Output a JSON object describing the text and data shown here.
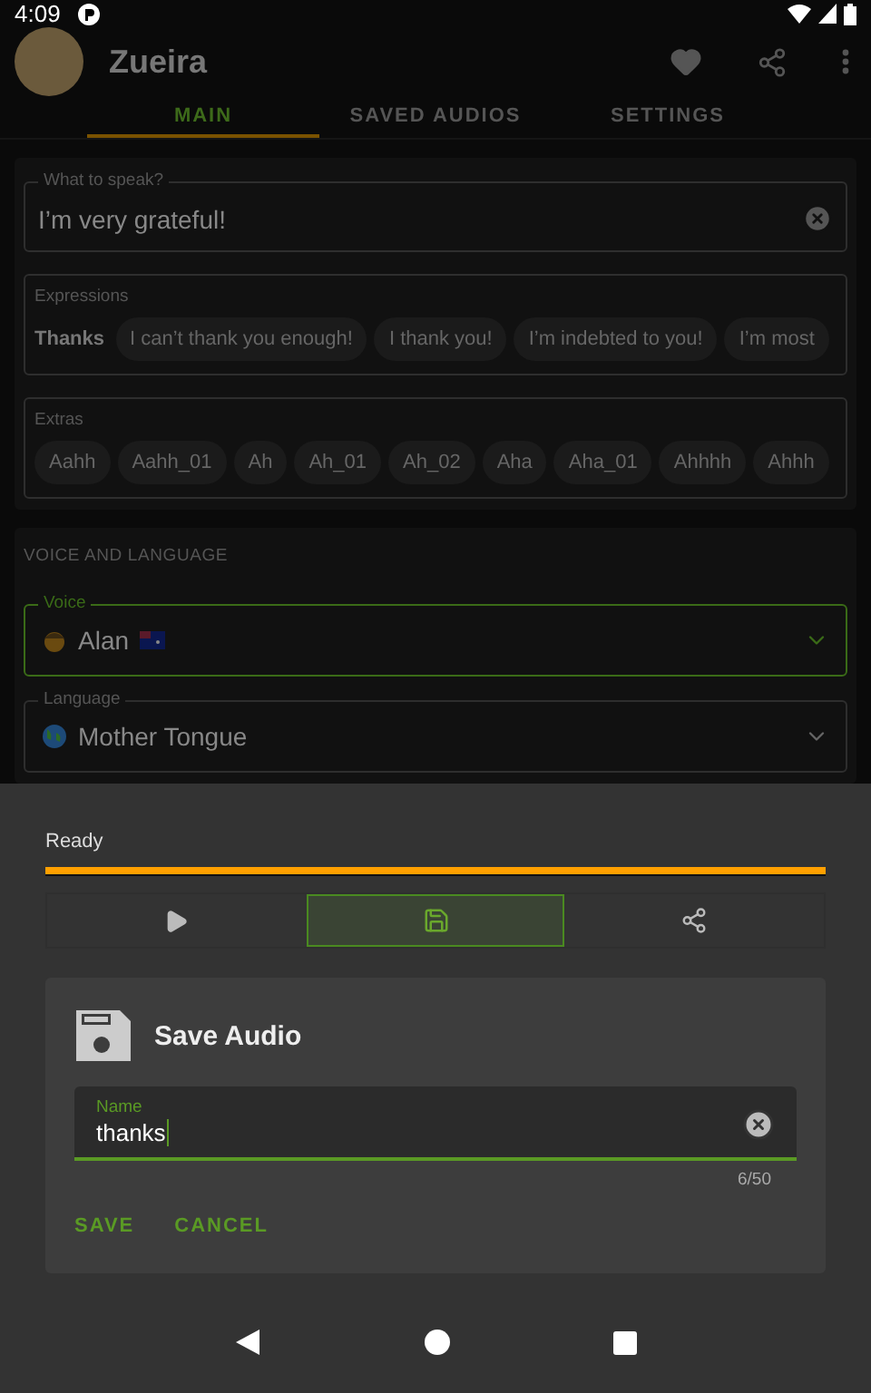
{
  "status_bar": {
    "time": "4:09"
  },
  "app_bar": {
    "title": "Zueira"
  },
  "tabs": [
    {
      "label": "MAIN",
      "selected": true
    },
    {
      "label": "SAVED AUDIOS",
      "selected": false
    },
    {
      "label": "SETTINGS",
      "selected": false
    }
  ],
  "speak_field": {
    "label": "What to speak?",
    "value": "I’m very grateful!"
  },
  "expressions": {
    "title": "Expressions",
    "category": "Thanks",
    "chips": [
      "I can’t thank you enough!",
      "I thank you!",
      "I’m indebted to you!",
      "I’m most"
    ]
  },
  "extras": {
    "title": "Extras",
    "chips": [
      "Aahh",
      "Aahh_01",
      "Ah",
      "Ah_01",
      "Ah_02",
      "Aha",
      "Aha_01",
      "Ahhhh",
      "Ahhh"
    ]
  },
  "voice_section": {
    "title": "VOICE AND LANGUAGE",
    "fields": [
      {
        "label": "Voice",
        "value": "Alan",
        "focused": true
      },
      {
        "label": "Language",
        "value": "Mother Tongue",
        "focused": false
      }
    ]
  },
  "player": {
    "status": "Ready",
    "level": 1,
    "actions": [
      {
        "kind": "play",
        "selected": false
      },
      {
        "kind": "save",
        "selected": true
      },
      {
        "kind": "share",
        "selected": false
      }
    ]
  },
  "dialog": {
    "title": "Save Audio",
    "field": {
      "label": "Name",
      "value": "thanks",
      "counter": "6/50"
    },
    "buttons": [
      "SAVE",
      "CANCEL"
    ]
  }
}
